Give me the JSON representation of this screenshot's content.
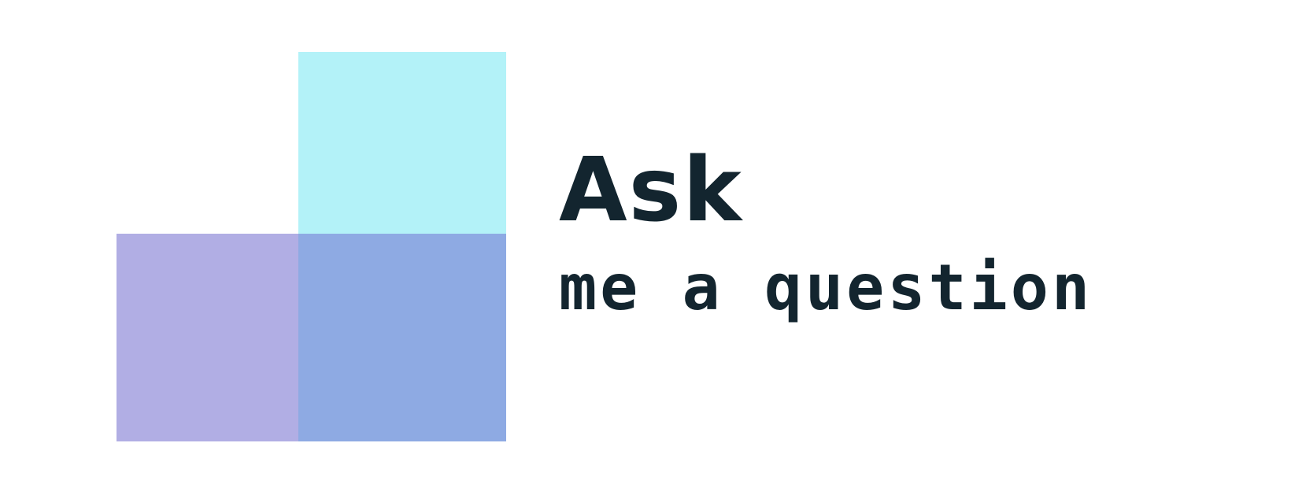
{
  "logo": {
    "title": "Ask",
    "subtitle": "me a question",
    "colors": {
      "top_block": "#b3f2f8",
      "left_block": "#b1aee4",
      "overlap_block": "#8eaae3",
      "text": "#13252f",
      "background": "#ffffff"
    }
  }
}
